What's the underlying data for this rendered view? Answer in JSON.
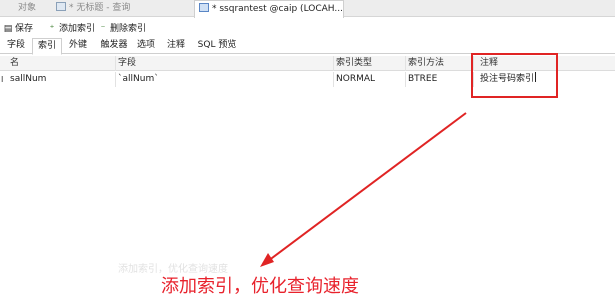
{
  "doc_tabs": [
    {
      "label": "对象",
      "icon": "none"
    },
    {
      "label": "* 无标题 - 查询",
      "icon": "query-icon"
    },
    {
      "label": "* ssqrantest @caip (LOCAH...",
      "icon": "table-icon"
    }
  ],
  "toolbar": {
    "save_label": "保存",
    "add_index_label": "添加索引",
    "delete_index_label": "删除索引"
  },
  "sub_tabs": [
    "字段",
    "索引",
    "外键",
    "触发器",
    "选项",
    "注释",
    "SQL 预览"
  ],
  "active_sub_tab": "索引",
  "grid": {
    "headers": [
      "名",
      "字段",
      "索引类型",
      "索引方法",
      "注释"
    ],
    "rows": [
      {
        "marker": "I",
        "name": "sallNum",
        "field": "`allNum`",
        "type": "NORMAL",
        "method": "BTREE",
        "comment": "投注号码索引"
      }
    ]
  },
  "faint_text": [
    "添加索引，优化查询速度"
  ],
  "caption": "添加索引，优化查询速度",
  "colors": {
    "annotation_red": "#e02424",
    "caption_red": "#e8222c",
    "tab_bar": "#ededed"
  }
}
